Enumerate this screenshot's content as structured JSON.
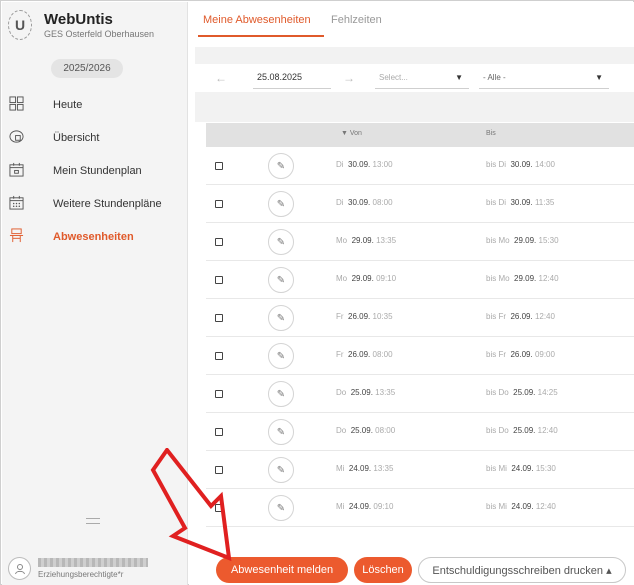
{
  "brand": {
    "logo": "U",
    "name": "WebUntis",
    "school": "GES Osterfeld Oberhausen"
  },
  "school_year": "2025/2026",
  "nav": [
    {
      "label": "Heute",
      "icon": "grid-icon"
    },
    {
      "label": "Übersicht",
      "icon": "overview-icon"
    },
    {
      "label": "Mein Stundenplan",
      "icon": "calendar-icon"
    },
    {
      "label": "Weitere Stundenpläne",
      "icon": "calendar-grid-icon"
    },
    {
      "label": "Abwesenheiten",
      "icon": "absence-icon",
      "active": true
    }
  ],
  "user": {
    "role": "Erziehungsberechtigte*r"
  },
  "tabs": [
    {
      "label": "Meine Abwesenheiten",
      "active": true
    },
    {
      "label": "Fehlzeiten"
    }
  ],
  "filters": {
    "date": "25.08.2025",
    "select1": "Select...",
    "select2": "- Alle -"
  },
  "table": {
    "col_from": "Von",
    "col_to": "Bis",
    "rows": [
      {
        "from_day": "Di",
        "from_date": "30.09.",
        "from_time": "13:00",
        "to_prefix": "bis Di",
        "to_date": "30.09.",
        "to_time": "14:00"
      },
      {
        "from_day": "Di",
        "from_date": "30.09.",
        "from_time": "08:00",
        "to_prefix": "bis Di",
        "to_date": "30.09.",
        "to_time": "11:35"
      },
      {
        "from_day": "Mo",
        "from_date": "29.09.",
        "from_time": "13:35",
        "to_prefix": "bis Mo",
        "to_date": "29.09.",
        "to_time": "15:30"
      },
      {
        "from_day": "Mo",
        "from_date": "29.09.",
        "from_time": "09:10",
        "to_prefix": "bis Mo",
        "to_date": "29.09.",
        "to_time": "12:40"
      },
      {
        "from_day": "Fr",
        "from_date": "26.09.",
        "from_time": "10:35",
        "to_prefix": "bis Fr",
        "to_date": "26.09.",
        "to_time": "12:40"
      },
      {
        "from_day": "Fr",
        "from_date": "26.09.",
        "from_time": "08:00",
        "to_prefix": "bis Fr",
        "to_date": "26.09.",
        "to_time": "09:00"
      },
      {
        "from_day": "Do",
        "from_date": "25.09.",
        "from_time": "13:35",
        "to_prefix": "bis Do",
        "to_date": "25.09.",
        "to_time": "14:25"
      },
      {
        "from_day": "Do",
        "from_date": "25.09.",
        "from_time": "08:00",
        "to_prefix": "bis Do",
        "to_date": "25.09.",
        "to_time": "12:40"
      },
      {
        "from_day": "Mi",
        "from_date": "24.09.",
        "from_time": "13:35",
        "to_prefix": "bis Mi",
        "to_date": "24.09.",
        "to_time": "15:30"
      },
      {
        "from_day": "Mi",
        "from_date": "24.09.",
        "from_time": "09:10",
        "to_prefix": "bis Mi",
        "to_date": "24.09.",
        "to_time": "12:40"
      }
    ]
  },
  "buttons": {
    "report": "Abwesenheit melden",
    "delete": "Löschen",
    "print": "Entschuldigungsschreiben drucken"
  },
  "colors": {
    "accent": "#e05a2b",
    "button": "#ec5a2e",
    "pointer": "#e02020"
  }
}
